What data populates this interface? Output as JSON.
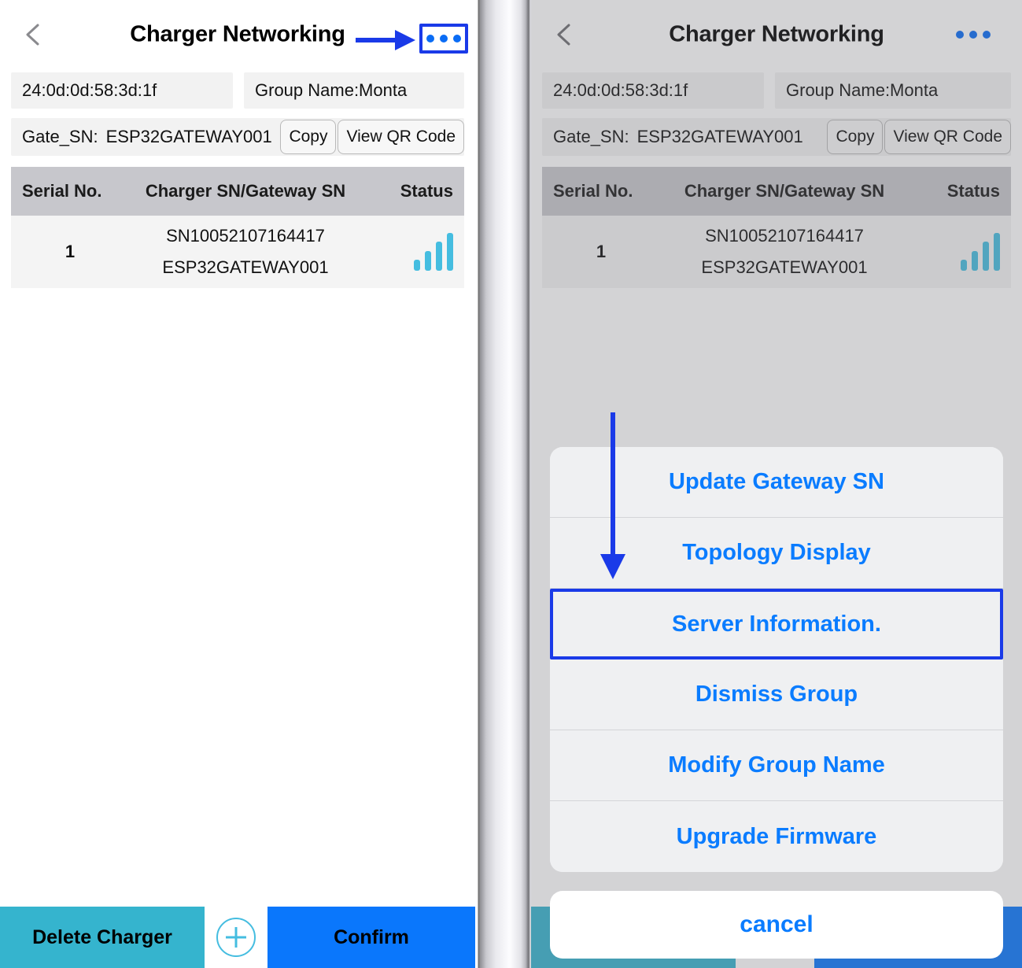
{
  "app": {
    "screen_title": "Charger Networking",
    "back_icon": "chevron-left-icon",
    "more_icon": "ellipsis-icon"
  },
  "device_info": {
    "mac_address": "24:0d:0d:58:3d:1f",
    "group_name": "Group Name:Monta",
    "gate_sn_label": "Gate_SN:",
    "gate_sn_value": "ESP32GATEWAY001",
    "copy_button": "Copy",
    "qr_button": "View QR Code"
  },
  "table": {
    "headers": [
      "Serial No.",
      "Charger SN/Gateway SN",
      "Status"
    ],
    "rows": [
      {
        "serial_no": "1",
        "charger_sn": "SN10052107164417",
        "gateway_sn": "ESP32GATEWAY001",
        "status_icon": "signal-bars-icon",
        "signal_level": 4
      }
    ]
  },
  "bottom_bar": {
    "delete_label": "Delete Charger",
    "add_icon": "plus-circle-icon",
    "confirm_label": "Confirm"
  },
  "action_sheet": {
    "items": [
      {
        "label": "Update Gateway SN",
        "highlighted": false
      },
      {
        "label": "Topology Display",
        "highlighted": false
      },
      {
        "label": "Server Information.",
        "highlighted": true
      },
      {
        "label": "Dismiss Group",
        "highlighted": false
      },
      {
        "label": "Modify Group Name",
        "highlighted": false
      },
      {
        "label": "Upgrade Firmware",
        "highlighted": false
      }
    ],
    "cancel_label": "cancel"
  },
  "annotations": {
    "right_arrow_icon": "arrow-right-annotation",
    "down_arrow_icon": "arrow-down-annotation",
    "highlight_color": "#1a3ae8"
  },
  "colors": {
    "accent_blue": "#0a7cff",
    "confirm_blue": "#0a77fc",
    "delete_teal": "#35b4ce",
    "signal_blue": "#45bde0",
    "field_gray": "#f2f2f2",
    "table_header_gray": "#c7c7cc",
    "annotation_blue": "#1a3ae8"
  }
}
